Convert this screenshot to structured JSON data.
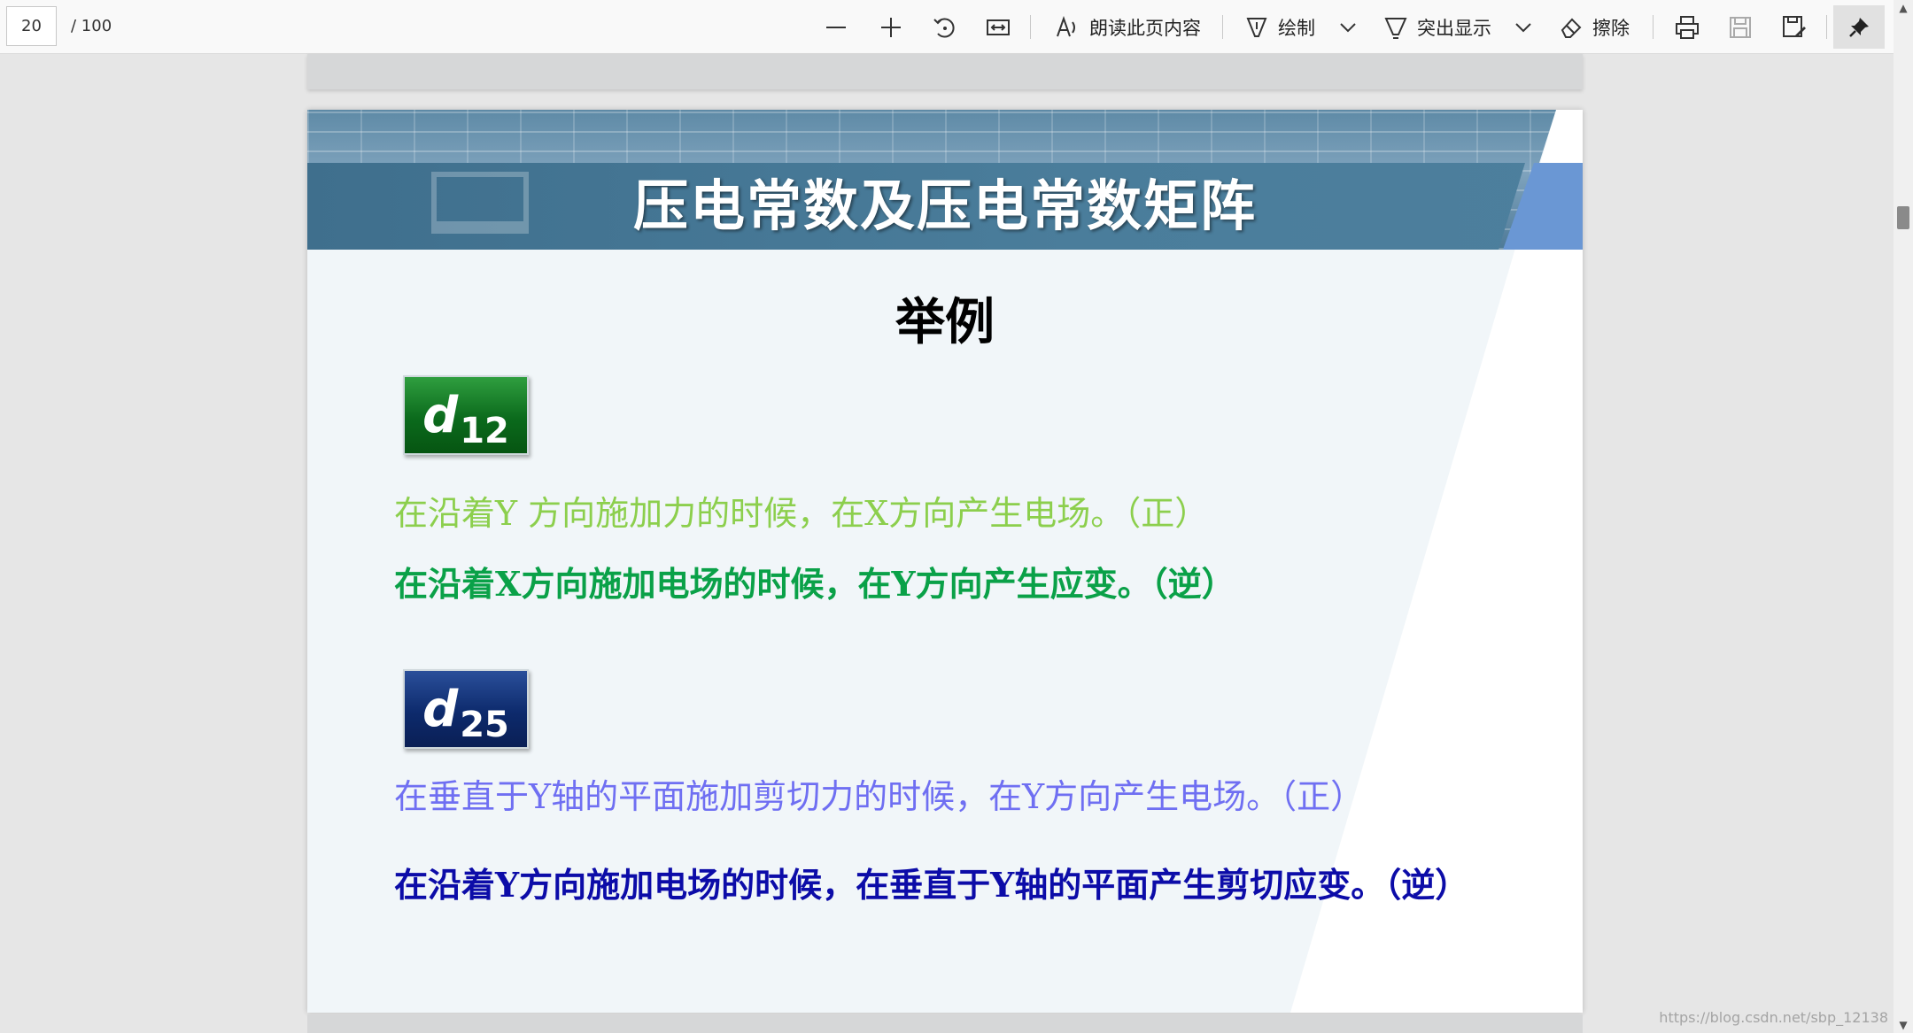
{
  "toolbar": {
    "page_number": "20",
    "page_total": "/ 100",
    "read_aloud_label": "朗读此页内容",
    "draw_label": "绘制",
    "highlight_label": "突出显示",
    "erase_label": "擦除"
  },
  "slide": {
    "title": "压电常数及压电常数矩阵",
    "subtitle": "举例",
    "badge1": {
      "symbol": "d",
      "subscript": "12"
    },
    "badge2": {
      "symbol": "d",
      "subscript": "25"
    },
    "line1": "在沿着Y 方向施加力的时候，在X方向产生电场。（正）",
    "line2": "在沿着X方向施加电场的时候，在Y方向产生应变。（逆）",
    "line3": "在垂直于Y轴的平面施加剪切力的时候，在Y方向产生电场。（正）",
    "line4": "在沿着Y方向施加电场的时候，在垂直于Y轴的平面产生剪切应变。（逆）",
    "colors": {
      "line1": "#8ccf4d",
      "line2": "#0aa148",
      "line3": "#6f6ff2",
      "line4": "#0c0ca8"
    }
  },
  "watermark": "https://blog.csdn.net/sbp_12138"
}
